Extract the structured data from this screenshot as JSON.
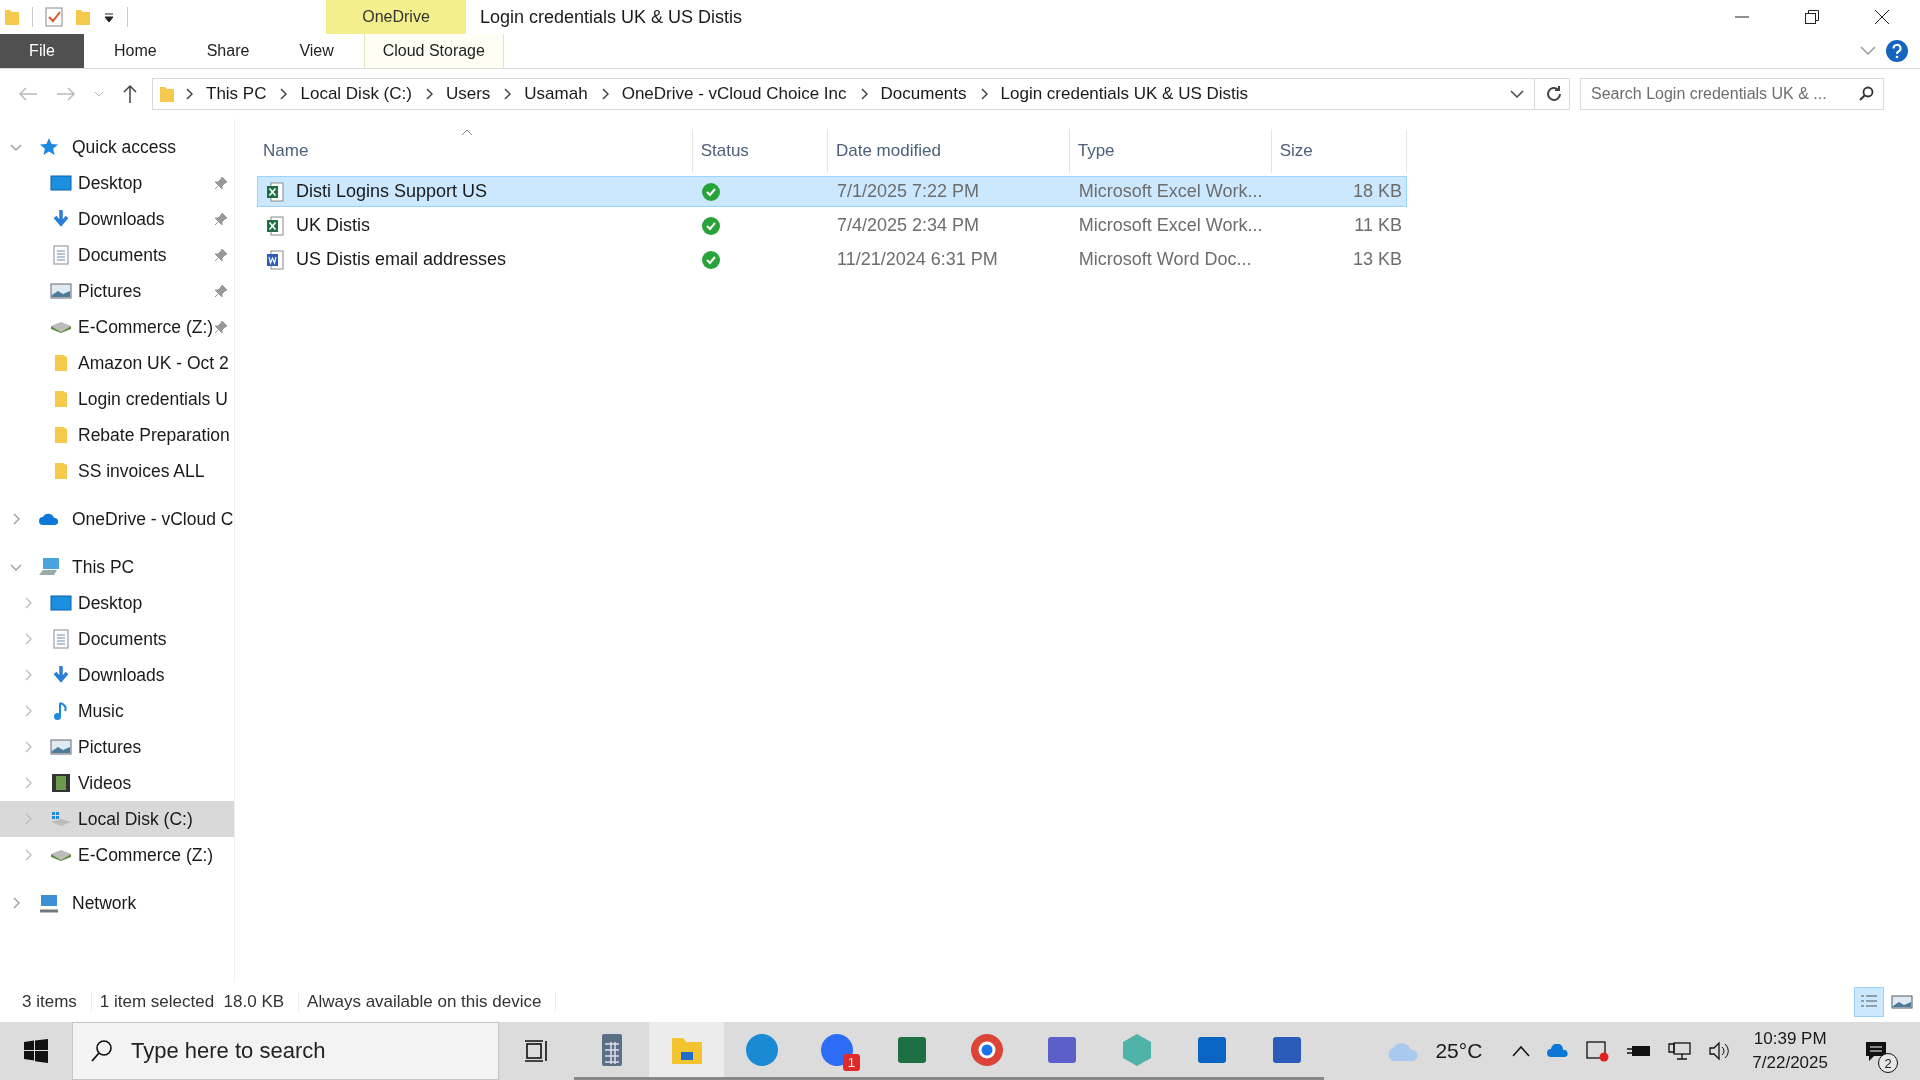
{
  "window": {
    "title": "Login credentials UK & US Distis",
    "context_group": "OneDrive"
  },
  "ribbon": {
    "tabs": [
      {
        "label": "File",
        "kind": "file",
        "selected": false
      },
      {
        "label": "Home",
        "kind": "tab",
        "selected": false
      },
      {
        "label": "Share",
        "kind": "tab",
        "selected": false
      },
      {
        "label": "View",
        "kind": "tab",
        "selected": false
      },
      {
        "label": "Cloud Storage",
        "kind": "context",
        "selected": false
      }
    ]
  },
  "address": {
    "crumbs": [
      "This PC",
      "Local Disk (C:)",
      "Users",
      "Usamah",
      "OneDrive - vCloud Choice Inc",
      "Documents",
      "Login credentials UK & US Distis"
    ],
    "search_placeholder": "Search Login credentials UK & ..."
  },
  "sidebar": {
    "items": [
      {
        "label": "Quick access",
        "kind": "star",
        "expanded": true,
        "selected": false,
        "children": [
          {
            "label": "Desktop",
            "kind": "desktop",
            "pinned": true,
            "selected": false
          },
          {
            "label": "Downloads",
            "kind": "downloads",
            "pinned": true,
            "selected": false
          },
          {
            "label": "Documents",
            "kind": "documents",
            "pinned": true,
            "selected": false
          },
          {
            "label": "Pictures",
            "kind": "pictures",
            "pinned": true,
            "selected": false
          },
          {
            "label": "E-Commerce (Z:)",
            "kind": "drive",
            "pinned": true,
            "selected": false
          },
          {
            "label": "Amazon UK - Oct 2",
            "kind": "folder",
            "pinned": false,
            "selected": false
          },
          {
            "label": "Login credentials U",
            "kind": "folder",
            "pinned": false,
            "selected": false
          },
          {
            "label": "Rebate Preparation",
            "kind": "folder",
            "pinned": false,
            "selected": false
          },
          {
            "label": "SS invoices ALL",
            "kind": "folder",
            "pinned": false,
            "selected": false
          }
        ]
      },
      {
        "label": "OneDrive - vCloud C",
        "kind": "cloud",
        "expanded": false,
        "selected": false
      },
      {
        "label": "This PC",
        "kind": "pc",
        "expanded": true,
        "selected": false,
        "children": [
          {
            "label": "Desktop",
            "kind": "desktop",
            "expanded": false,
            "selected": false
          },
          {
            "label": "Documents",
            "kind": "documents",
            "expanded": false,
            "selected": false
          },
          {
            "label": "Downloads",
            "kind": "downloads",
            "expanded": false,
            "selected": false
          },
          {
            "label": "Music",
            "kind": "music",
            "expanded": false,
            "selected": false
          },
          {
            "label": "Pictures",
            "kind": "pictures",
            "expanded": false,
            "selected": false
          },
          {
            "label": "Videos",
            "kind": "videos",
            "expanded": false,
            "selected": false
          },
          {
            "label": "Local Disk (C:)",
            "kind": "windisk",
            "expanded": false,
            "selected": true
          },
          {
            "label": "E-Commerce (Z:)",
            "kind": "drive",
            "expanded": false,
            "selected": false
          }
        ]
      },
      {
        "label": "Network",
        "kind": "network",
        "expanded": false,
        "selected": false
      }
    ]
  },
  "table": {
    "columns": [
      "Name",
      "Status",
      "Date modified",
      "Type",
      "Size"
    ],
    "rows": [
      {
        "name": "Disti Logins Support US",
        "kind": "excel",
        "synced": true,
        "date": "7/1/2025 7:22 PM",
        "type": "Microsoft Excel Work...",
        "size": "18 KB",
        "selected": true
      },
      {
        "name": "UK Distis",
        "kind": "excel",
        "synced": true,
        "date": "7/4/2025 2:34 PM",
        "type": "Microsoft Excel Work...",
        "size": "11 KB",
        "selected": false
      },
      {
        "name": "US Distis email addresses",
        "kind": "word",
        "synced": true,
        "date": "11/21/2024 6:31 PM",
        "type": "Microsoft Word Doc...",
        "size": "13 KB",
        "selected": false
      }
    ]
  },
  "status_bar": {
    "count": "3 items",
    "selection": "1 item selected  18.0 KB",
    "availability": "Always available on this device"
  },
  "taskbar": {
    "search_placeholder": "Type here to search",
    "apps": [
      {
        "kind": "calculator",
        "active": false
      },
      {
        "kind": "explorer",
        "active": true
      },
      {
        "kind": "edge",
        "active": false
      },
      {
        "kind": "zoom",
        "active": false,
        "badge": "1"
      },
      {
        "kind": "excel",
        "active": false
      },
      {
        "kind": "chrome",
        "active": false
      },
      {
        "kind": "teams",
        "active": false
      },
      {
        "kind": "diamond",
        "active": false
      },
      {
        "kind": "outlook",
        "active": false
      },
      {
        "kind": "word",
        "active": false
      }
    ],
    "weather": "25°C",
    "time": "10:39 PM",
    "date": "7/22/2025",
    "notifications": "2"
  }
}
